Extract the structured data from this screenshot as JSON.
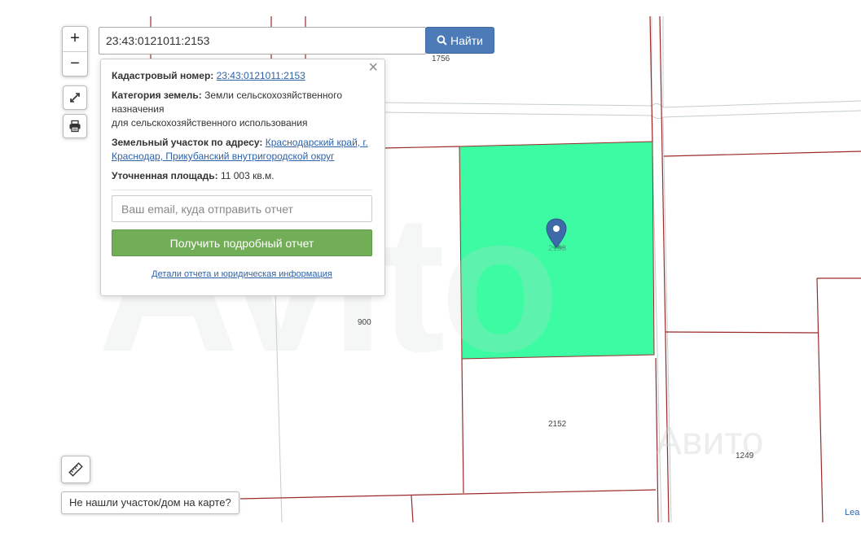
{
  "map": {
    "zoom_in_label": "+",
    "zoom_out_label": "−",
    "fullscreen_icon": "expand-icon",
    "print_icon": "printer-icon",
    "ruler_icon": "ruler-icon",
    "parcel_labels": [
      "1756",
      "900",
      "2152",
      "1249",
      "2153"
    ],
    "selected_parcel_color": "#3dfba3",
    "boundary_color": "#9b2a2a",
    "road_color": "#c4cdd2",
    "watermark_text": "Avito",
    "watermark_small_text": "Авито",
    "attribution": "Lea"
  },
  "search": {
    "value": "23:43:0121011:2153",
    "button_label": "Найти",
    "button_color": "#4d7bb7"
  },
  "popup": {
    "close_label": "×",
    "cadastral_label": "Кадастровый номер:",
    "cadastral_value": "23:43:0121011:2153",
    "category_label": "Категория земель:",
    "category_value_1": "Земли сельскохозяйственного назначения",
    "category_value_2": "для сельскохозяйственного использования",
    "address_label": "Земельный участок по адресу:",
    "address_value": "Краснодарский край, г. Краснодар, Прикубанский внутригородской округ",
    "area_label": "Уточненная площадь:",
    "area_value": "11 003 кв.м.",
    "email_placeholder": "Ваш email, куда отправить отчет",
    "report_button_label": "Получить подробный отчет",
    "report_button_color": "#72ad58",
    "details_link": "Детали отчета и юридическая информация"
  },
  "not_found_label": "Не нашли участок/дом на карте?"
}
